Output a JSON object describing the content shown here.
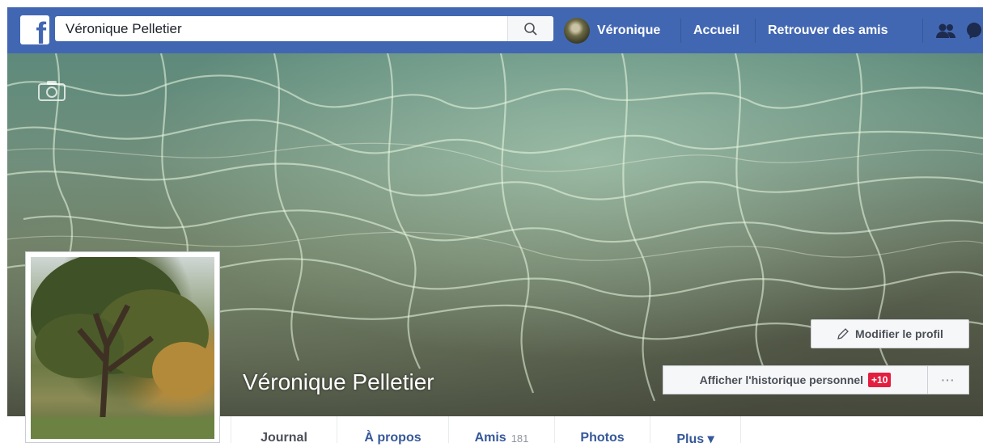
{
  "header": {
    "logo_letter": "f",
    "search": {
      "value": "Véronique Pelletier",
      "placeholder": ""
    },
    "user": {
      "name": "Véronique",
      "avatar": "tree-avatar"
    },
    "nav": {
      "home": "Accueil",
      "find_friends": "Retrouver des amis"
    },
    "icons": [
      "search-icon",
      "friend-requests-icon",
      "messages-icon"
    ],
    "accent_color": "#4267b2"
  },
  "cover": {
    "name": "Véronique Pelletier",
    "camera_icon": "camera-icon",
    "edit_profile_label": "Modifier le profil",
    "edit_icon": "pencil-icon",
    "history_label": "Afficher l'historique personnel",
    "history_badge": "+10",
    "more_label": "···"
  },
  "tabs": {
    "journal": "Journal",
    "about": "À propos",
    "friends": "Amis",
    "friends_count": "181",
    "photos": "Photos",
    "more": "Plus ▾"
  }
}
